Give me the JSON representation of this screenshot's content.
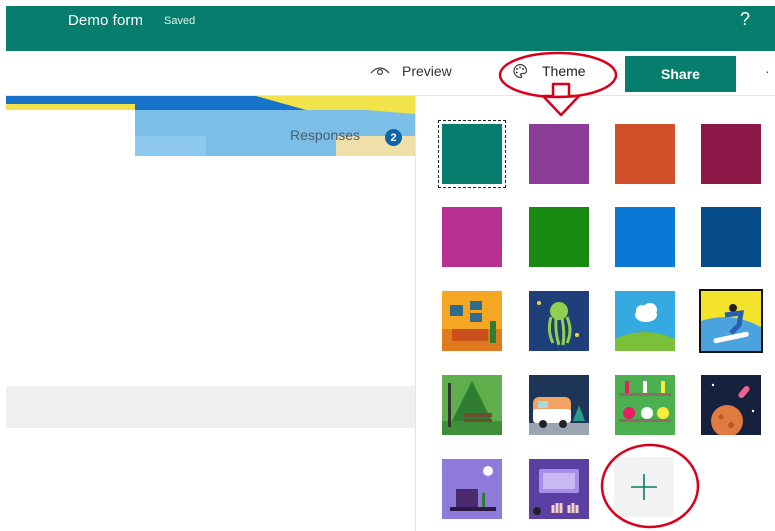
{
  "header": {
    "title": "Demo form",
    "status": "Saved",
    "help": "?"
  },
  "toolbar": {
    "preview_label": "Preview",
    "theme_label": "Theme",
    "share_label": "Share",
    "more": "·"
  },
  "form": {
    "responses_label": "Responses",
    "responses_count": "2"
  },
  "colors": {
    "brand": "#077d6e",
    "panel_bg": "#ffffff",
    "annotation": "#d9001b"
  },
  "theme_panel": {
    "colors": [
      "#077d6e",
      "#8b3c96",
      "#d0502a",
      "#8c1848",
      "#b72f93",
      "#198a11",
      "#0c78d6",
      "#074c8a"
    ],
    "images": [
      "living-room",
      "octopus",
      "cloud-hill",
      "snowboarder",
      "park-bench",
      "camper-van",
      "chemistry-flasks",
      "rocket-planet",
      "desk-lamp",
      "keyboard-hands"
    ],
    "add_icon": "plus-icon"
  }
}
